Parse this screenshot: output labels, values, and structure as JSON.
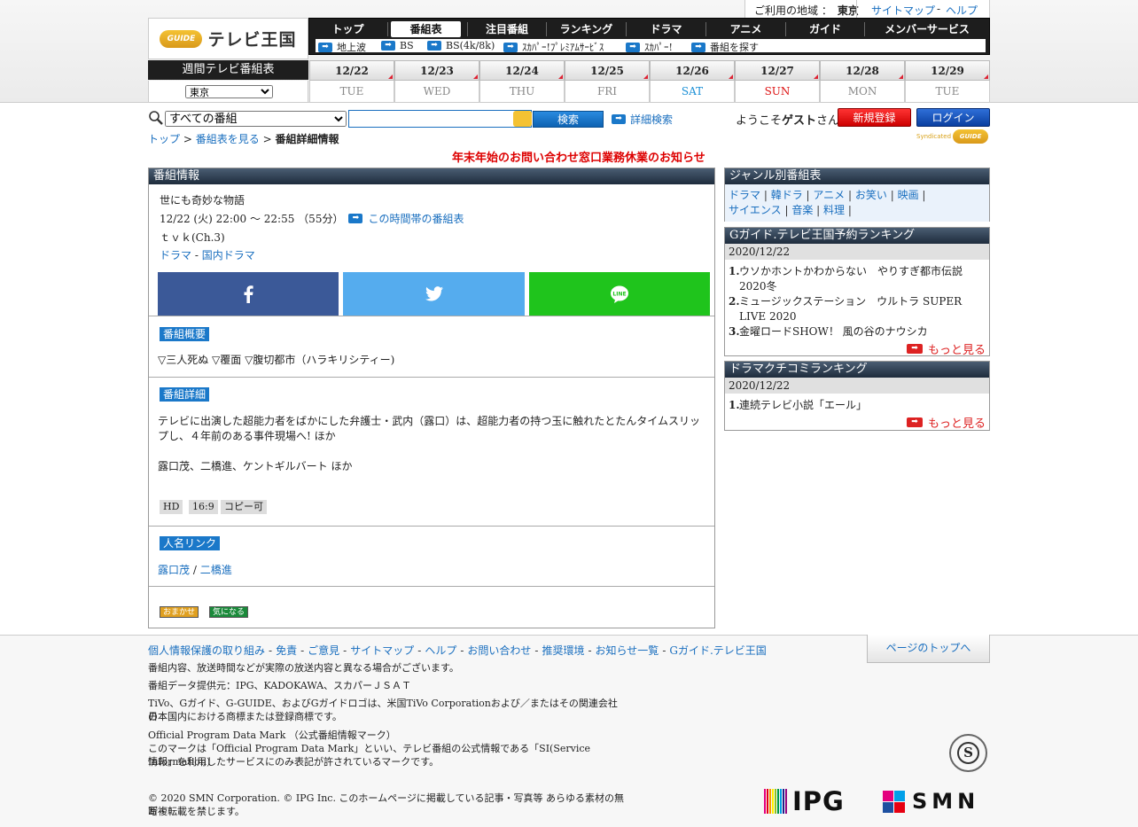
{
  "topbar": {
    "region_label": "ご利用の地域 ：",
    "region_value": "東京",
    "sitemap": "サイトマップ",
    "dash": "-",
    "help": "ヘルプ"
  },
  "logo": {
    "gmark": "GUIDE",
    "text": "テレビ王国"
  },
  "gnav": [
    "トップ",
    "番組表",
    "注目番組",
    "ランキング",
    "ドラマ",
    "アニメ",
    "ガイド",
    "メンバーサービス"
  ],
  "subnav": [
    "地上波",
    "BS",
    "BS(4k/8k)",
    "ｽｶﾊﾟｰ!ﾌﾟﾚﾐｱﾑｻｰﾋﾞｽ",
    "ｽｶﾊﾟｰ!",
    "番組を探す"
  ],
  "week": {
    "label": "週間テレビ番組表",
    "area": "東京",
    "dates": [
      {
        "date": "12/22",
        "dow": "TUE",
        "color": "#888888"
      },
      {
        "date": "12/23",
        "dow": "WED",
        "color": "#888888"
      },
      {
        "date": "12/24",
        "dow": "THU",
        "color": "#888888"
      },
      {
        "date": "12/25",
        "dow": "FRI",
        "color": "#888888"
      },
      {
        "date": "12/26",
        "dow": "SAT",
        "color": "#1a8fd6"
      },
      {
        "date": "12/27",
        "dow": "SUN",
        "color": "#dd1111"
      },
      {
        "date": "12/28",
        "dow": "MON",
        "color": "#888888"
      },
      {
        "date": "12/29",
        "dow": "TUE",
        "color": "#888888"
      }
    ]
  },
  "search": {
    "category": "すべての番組",
    "value": "",
    "button": "検索",
    "advanced": "詳細検索"
  },
  "user": {
    "welcome_pre": "ようこそ",
    "guest": "ゲスト",
    "welcome_post": "さん",
    "register": "新規登録",
    "login": "ログイン"
  },
  "breadcrumb": {
    "top": "トップ",
    "sep": ">",
    "schedule": "番組表を見る",
    "current": "番組詳細情報"
  },
  "syndicated": {
    "text": "Syndicated",
    "mark": "GUIDE"
  },
  "notice": "年末年始のお問い合わせ窓口業務休業のお知らせ",
  "program": {
    "header": "番組情報",
    "title": "世にも奇妙な物語",
    "datetime": "12/22 (火) 22:00 ～ 22:55 （55分）",
    "timeslot_link": "この時間帯の番組表",
    "channel": "ｔｖｋ(Ch.3)",
    "genre1": "ドラマ",
    "genre_sep": "-",
    "genre2": "国内ドラマ",
    "summary_tag": "番組概要",
    "summary": "▽三人死ぬ ▽覆面 ▽腹切都市（ハラキリシティー)",
    "detail_tag": "番組詳細",
    "detail": "テレビに出演した超能力者をばかにした弁護士・武内（露口）は、超能力者の持つ玉に触れたとたんタイムスリップし、４年前のある事件現場へ! ほか",
    "cast": "露口茂、二橋進、ケントギルバート ほか",
    "badges": [
      "HD",
      "16:9",
      "コピー可"
    ],
    "people_tag": "人名リンク",
    "person1": "露口茂",
    "person_sep": "/",
    "person2": "二橋進",
    "btn_omakase": "おまかせ",
    "btn_kininaru": "気になる"
  },
  "genre_box": {
    "header": "ジャンル別番組表",
    "items": [
      "ドラマ",
      "韓ドラ",
      "アニメ",
      "お笑い",
      "映画",
      "サイエンス",
      "音楽",
      "料理"
    ]
  },
  "ranking1": {
    "header": "Gガイド.テレビ王国予約ランキング",
    "date": "2020/12/22",
    "items": [
      {
        "rank": "1.",
        "text": "ウソかホントかわからない　やりすぎ都市伝説2020冬"
      },
      {
        "rank": "2.",
        "text": "ミュージックステーション　ウルトラ SUPER LIVE 2020"
      },
      {
        "rank": "3.",
        "text": "金曜ロードSHOW！ 風の谷のナウシカ"
      }
    ],
    "more": "もっと見る"
  },
  "ranking2": {
    "header": "ドラマクチコミランキング",
    "date": "2020/12/22",
    "items": [
      {
        "rank": "1.",
        "text": "連続テレビ小説「エール」"
      }
    ],
    "more": "もっと見る"
  },
  "footer": {
    "links": [
      "個人情報保護の取り組み",
      "免責",
      "ご意見",
      "サイトマップ",
      "ヘルプ",
      "お問い合わせ",
      "推奨環境",
      "お知らせ一覧",
      "Gガイド.テレビ王国"
    ],
    "pagetop": "ページのトップへ",
    "l1": "番組内容、放送時間などが実際の放送内容と異なる場合がございます。",
    "l2": "番組データ提供元：IPG、KADOKAWA、スカパーＪＳＡＴ",
    "l3a": "TiVo、Gガイド、G-GUIDE、およびGガイドロゴは、米国TiVo Corporationおよび／またはその関連会社の",
    "l3b": "日本国内における商標または登録商標です。",
    "l4a": "Official Program Data Mark （公式番組情報マーク）",
    "l4b": "このマークは「Official Program Data Mark」といい、テレビ番組の公式情報である「SI(Service Information)",
    "l4c": "情報」を利用したサービスにのみ表記が許されているマークです。",
    "l5a": "© 2020 SMN Corporation. © IPG Inc. このホームページに掲載している記事・写真等 あらゆる素材の無断複",
    "l5b": "写・転載を禁じます。",
    "seal": "S",
    "ipg": "IPG",
    "smn": "SMN"
  }
}
